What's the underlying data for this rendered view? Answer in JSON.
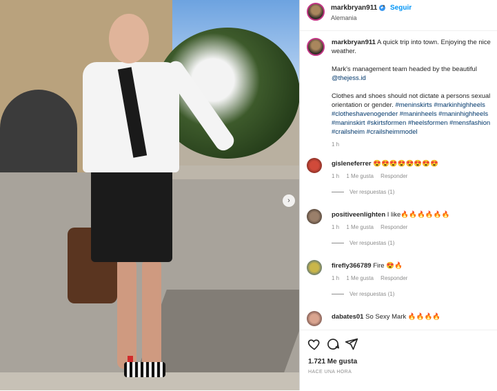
{
  "post": {
    "username": "markbryan911",
    "location": "Alemania",
    "dot": "•",
    "follow_label": "Seguir",
    "verified_glyph": "✔",
    "caption": {
      "username": "markbryan911",
      "line1": "A quick trip into town. Enjoying the nice weather.",
      "line2": "Mark's management team headed by the beautiful",
      "mention": "@thejess.id",
      "line3": "Clothes and shoes should not dictate a persons sexual orientation or gender.",
      "hashtags": "#meninskirts #markinhighheels #clotheshavenogender #maninheels #maninhighheels #maninskirt #skirtsformen #heelsformen #mensfashion #crailsheim #crailsheimmodel",
      "time": "1 h"
    },
    "comments": [
      {
        "user": "gisleneferrer",
        "text": "😍😍😍😍😍😍😍😍",
        "time": "1 h",
        "likes": "1 Me gusta",
        "reply": "Responder",
        "replies": "Ver respuestas (1)"
      },
      {
        "user": "positiveenlighten",
        "text": "I like🔥🔥🔥🔥🔥🔥",
        "time": "1 h",
        "likes": "1 Me gusta",
        "reply": "Responder",
        "replies": "Ver respuestas (1)"
      },
      {
        "user": "firefly366789",
        "text": "Fire 😍🔥",
        "time": "1 h",
        "likes": "1 Me gusta",
        "reply": "Responder",
        "replies": "Ver respuestas (1)"
      },
      {
        "user": "dabates01",
        "text": "So Sexy Mark 🔥🔥🔥🔥"
      }
    ],
    "likes_count": "1.721 Me gusta",
    "posted_ago": "HACE UNA HORA",
    "icons": [
      "heart-icon",
      "comment-icon",
      "share-icon"
    ],
    "carousel_next": "›"
  }
}
